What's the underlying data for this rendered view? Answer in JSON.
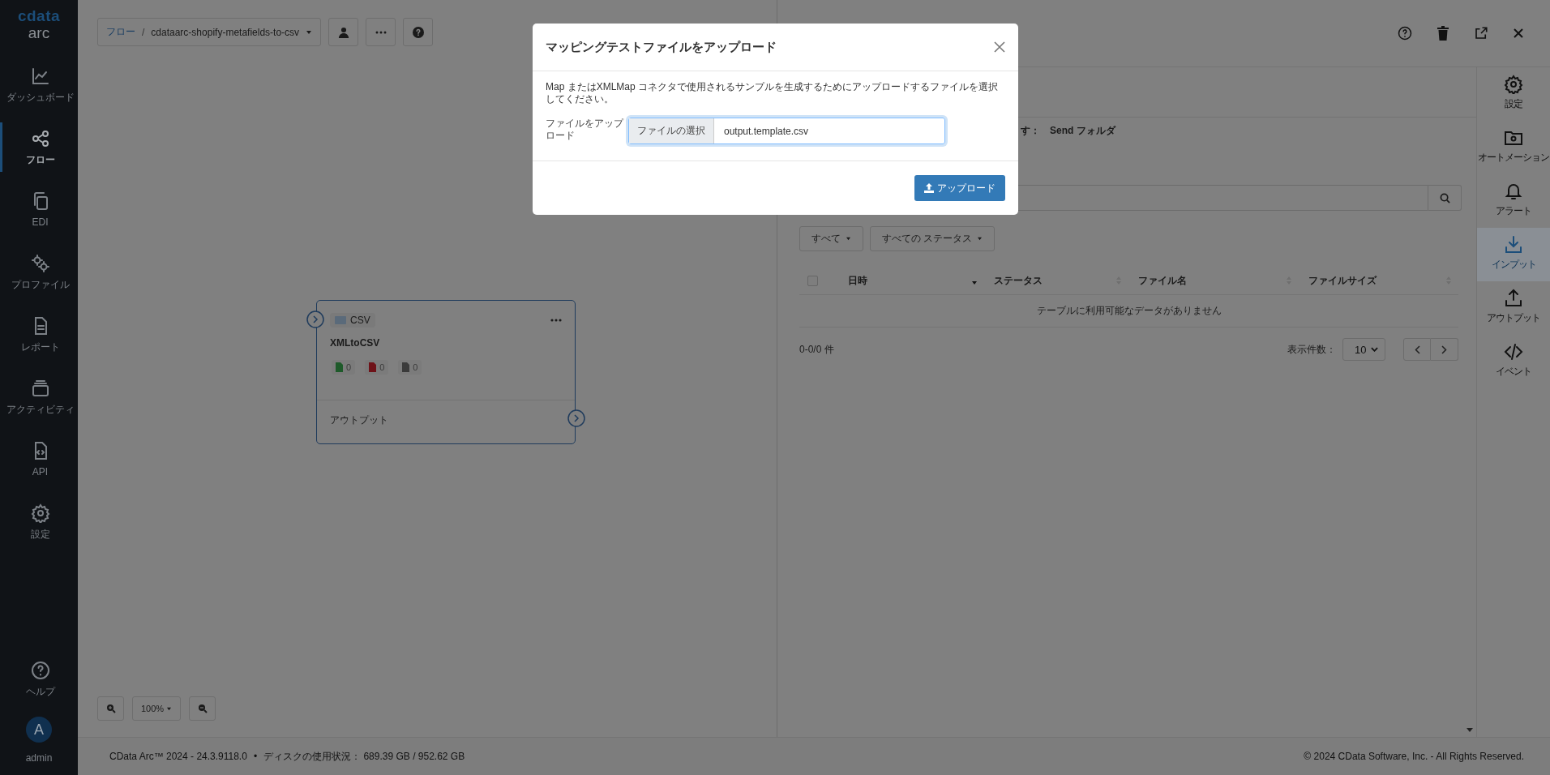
{
  "sidebar": {
    "logo": {
      "brand": "cdata",
      "product": "arc"
    },
    "items": [
      {
        "label": "ダッシュボード",
        "selected": false
      },
      {
        "label": "フロー",
        "selected": true
      },
      {
        "label": "EDI",
        "selected": false
      },
      {
        "label": "プロファイル",
        "selected": false
      },
      {
        "label": "レポート",
        "selected": false
      },
      {
        "label": "アクティビティ",
        "selected": false
      },
      {
        "label": "API",
        "selected": false
      },
      {
        "label": "設定",
        "selected": false
      }
    ],
    "help": {
      "label": "ヘルプ"
    },
    "user": {
      "initial": "A",
      "name": "admin"
    }
  },
  "toolbar": {
    "breadcrumb": [
      "フロー",
      "/",
      "cdataarc-shopify-metafields-to-csv"
    ]
  },
  "node": {
    "type": "CSV",
    "title": "XMLtoCSV",
    "counts": [
      {
        "value": "0",
        "color": "#1e5a2a"
      },
      {
        "value": "0",
        "color": "#6e1218"
      },
      {
        "value": "0",
        "color": "#3a3a3a"
      }
    ],
    "output": "アウトプット"
  },
  "zoom": {
    "level": "100%"
  },
  "panel": {
    "send_hint": "す：",
    "send_folder": "Send フォルダ",
    "filters": [
      "すべて",
      "すべての ステータス"
    ],
    "table": {
      "columns": [
        {
          "label": "日時",
          "sorted": true
        },
        {
          "label": "ステータス",
          "sorted": false
        },
        {
          "label": "ファイル名",
          "sorted": false
        },
        {
          "label": "ファイルサイズ",
          "sorted": false
        }
      ],
      "select_all": {
        "checked": false
      },
      "empty": "テーブルに利用可能なデータがありません"
    },
    "count": "0-0/0 件",
    "page_size_label": "表示件数：",
    "page_size": "10"
  },
  "side_tabs": [
    {
      "label": "設定",
      "selected": false
    },
    {
      "label": "オートメーション",
      "selected": false
    },
    {
      "label": "アラート",
      "selected": false
    },
    {
      "label": "インプット",
      "selected": true
    },
    {
      "label": "アウトプット",
      "selected": false
    },
    {
      "label": "イベント",
      "selected": false
    }
  ],
  "status_bar": {
    "version": "CData Arc™ 2024 - 24.3.9118.0",
    "separator": "•",
    "disk": "ディスクの使用状況： 689.39 GB / 952.62 GB",
    "copyright": "© 2024 CData Software, Inc. - All Rights Reserved."
  },
  "dialog": {
    "title": "マッピングテストファイルをアップロード",
    "description": "Map またはXMLMap コネクタで使用されるサンプルを生成するためにアップロードするファイルを選択してください。",
    "field_label": "ファイルをアップロード",
    "choose_button": "ファイルの選択",
    "file_name": "output.template.csv",
    "upload_button": "アップロード"
  }
}
